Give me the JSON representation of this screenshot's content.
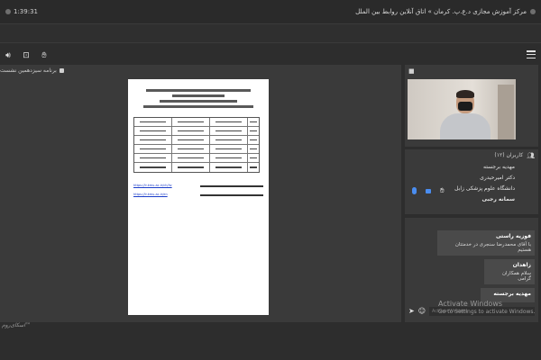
{
  "header": {
    "elapsed_time": "1:39:31",
    "title": "مرکز آموزش مجازی د.ع.پ. کرمان » اتاق آنلاین روابط بین الملل"
  },
  "main": {
    "panel_title": "برنامه سیزدهمین نشست",
    "document": {
      "link1": "https://lr.kmu.ac.ir/ch/liv",
      "link2": "https://lr.kmu.ac.ir/en"
    }
  },
  "video_panel": {
    "title": ""
  },
  "users_panel": {
    "title": "کاربران (۱۲)",
    "users": [
      {
        "name": "مهدیه برجسته",
        "bold": false
      },
      {
        "name": "دکتر امیرحیدری",
        "bold": false
      },
      {
        "name": "دانشگاه علوم پزشکی زابل",
        "bold": false
      },
      {
        "name": "سمانه رجبی",
        "bold": true
      }
    ]
  },
  "chat_panel": {
    "messages": [
      {
        "name": "فوزیه راستی",
        "text": "با آقای محمدرضا سنجری در خدمتتان هستیم"
      },
      {
        "name": "زاهدان",
        "text": "سلام همکاران گرامی"
      },
      {
        "name": "مهدیه برجسته",
        "text": ""
      }
    ],
    "input_placeholder": "Activate Windows"
  },
  "overlay": {
    "activate_title": "Activate Windows",
    "activate_sub": "Go to Settings to activate Windows."
  },
  "footer": {
    "watermark": "اسکای‌روم™"
  }
}
